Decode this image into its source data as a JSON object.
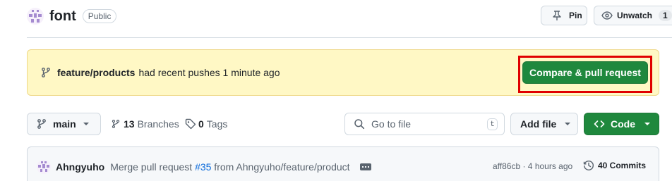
{
  "repo": {
    "name": "font",
    "visibility": "Public",
    "pin_label": "Pin",
    "watch_label": "Unwatch",
    "watch_count": "1"
  },
  "push_banner": {
    "branch": "feature/products",
    "message": "had recent pushes 1 minute ago",
    "button_label": "Compare & pull request"
  },
  "toolbar": {
    "branch": "main",
    "branches_count": "13",
    "branches_label": "Branches",
    "tags_count": "0",
    "tags_label": "Tags",
    "search_placeholder": "Go to file",
    "search_shortcut": "t",
    "add_file_label": "Add file",
    "code_label": "Code"
  },
  "latest_commit": {
    "author": "Ahngyuho",
    "message_prefix": "Merge pull request ",
    "pr_link": "#35",
    "message_suffix": " from Ahngyuho/feature/product",
    "meta": "aff86cb · 4 hours ago",
    "commits_label": "40 Commits"
  },
  "colors": {
    "primary_green": "#1f883d",
    "banner_bg": "#fff8c5",
    "highlight_red": "#e00000",
    "link_blue": "#0969da"
  },
  "icons": [
    "pin-icon",
    "eye-icon",
    "git-branch-icon",
    "tag-icon",
    "search-icon",
    "code-icon",
    "history-icon",
    "kebab-icon"
  ]
}
